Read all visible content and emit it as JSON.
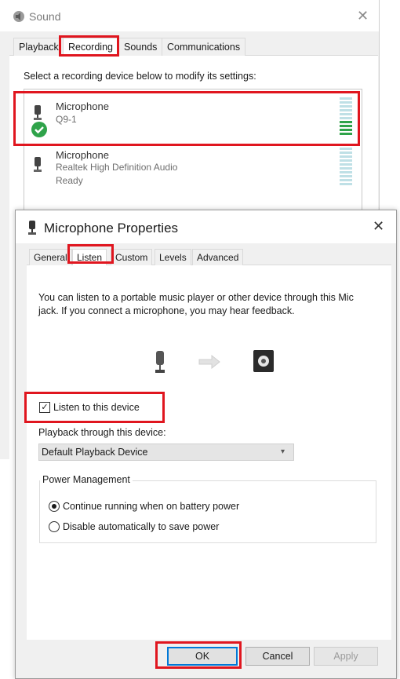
{
  "sound": {
    "title": "Sound",
    "close_glyph": "✕",
    "tabs": [
      "Playback",
      "Recording",
      "Sounds",
      "Communications"
    ],
    "instruction": "Select a recording device below to modify its settings:",
    "devices": [
      {
        "name": "Microphone",
        "sub": "Q9-1",
        "status": "",
        "default": true,
        "level_fraction": 0.4
      },
      {
        "name": "Microphone",
        "sub": "Realtek High Definition Audio",
        "status": "Ready",
        "default": false,
        "level_fraction": 0
      }
    ]
  },
  "dialog": {
    "title": "Microphone Properties",
    "close_glyph": "✕",
    "tabs": [
      "General",
      "Listen",
      "Custom",
      "Levels",
      "Advanced"
    ],
    "description": "You can listen to a portable music player or other device through this Mic jack.  If you connect a microphone, you may hear feedback.",
    "listen_checkbox": {
      "label": "Listen to this device",
      "checked": true
    },
    "playback_label": "Playback through this device:",
    "playback_value": "Default Playback Device",
    "power": {
      "legend": "Power Management",
      "options": [
        {
          "label": "Continue running when on battery power",
          "selected": true
        },
        {
          "label": "Disable automatically to save power",
          "selected": false
        }
      ]
    },
    "buttons": {
      "ok": "OK",
      "cancel": "Cancel",
      "apply": "Apply"
    }
  },
  "colors": {
    "highlight": "#e0161f",
    "level_on": "#2fa34a",
    "level_off": "#bfe0e6",
    "default_check": "#2fa34a"
  },
  "icons": [
    "speaker-icon",
    "microphone-icon",
    "green-check-icon",
    "arrow-right-icon",
    "speaker-box-icon",
    "chevron-down-icon"
  ]
}
